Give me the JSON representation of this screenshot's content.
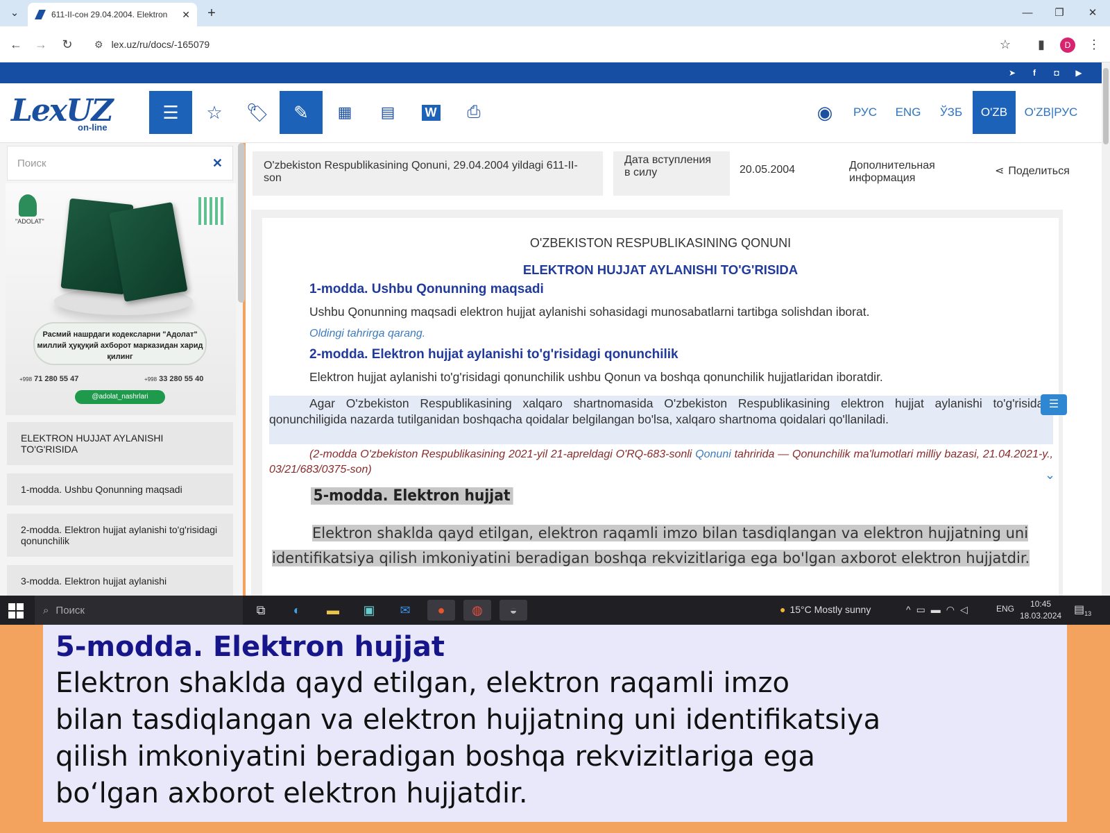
{
  "browser": {
    "tab_title": "611-II-сон 29.04.2004. Elektron",
    "url": "lex.uz/ru/docs/-165079",
    "profile_initial": "D"
  },
  "site": {
    "logo_main": "LexUZ",
    "logo_sub": "on-line",
    "languages": [
      "РУС",
      "ENG",
      "ЎЗБ",
      "O'ZB",
      "O'ZB|РУС"
    ],
    "active_language": "O'ZB",
    "toolbar_icons": [
      "menu-icon",
      "star-icon",
      "tags-icon",
      "edit-doc-icon",
      "calendar-icon",
      "compare-icon",
      "word-icon",
      "print-icon"
    ]
  },
  "sidebar": {
    "search_placeholder": "Поиск",
    "banner": {
      "logo_text": "\"ADOLAT\"",
      "caption": "Расмий нашрдаги кодексларни \"Адолат\" миллий ҳуқуқий ахборот марказидан харид қилинг",
      "phone1_prefix": "+998",
      "phone1": "71 280 55 47",
      "phone2_prefix": "+998",
      "phone2": "33 280 55 40",
      "telegram": "@adolat_nashrlari"
    },
    "items": [
      "ELEKTRON HUJJAT AYLANISHI TO'G'RISIDA",
      "1-modda. Ushbu Qonunning maqsadi",
      "2-modda. Elektron hujjat aylanishi to'g'risidagi qonunchilik",
      "3-modda. Elektron hujjat aylanishi"
    ]
  },
  "doc": {
    "title": "O'zbekiston Respublikasining Qonuni, 29.04.2004 yildagi 611-II-son",
    "effective_label": "Дата вступления в силу",
    "effective_date": "20.05.2004",
    "additional_info": "Дополнительная информация",
    "share": "Поделиться",
    "law_type": "O'ZBEKISTON RESPUBLIKASINING QONUNI",
    "law_title": "ELEKTRON HUJJAT AYLANISHI TO'G'RISIDA",
    "art1_title": "1-modda. Ushbu Qonunning maqsadi",
    "art1_text": "Ushbu Qonunning maqsadi elektron hujjat aylanishi sohasidagi munosabatlarni tartibga solishdan iborat.",
    "prev_edition": "Oldingi tahrirga qarang.",
    "art2_title": "2-modda. Elektron hujjat aylanishi to'g'risidagi qonunchilik",
    "art2_text1": "Elektron hujjat aylanishi to'g'risidagi qonunchilik ushbu Qonun va boshqa qonunchilik hujjatlaridan iboratdir.",
    "art2_text2": "Agar O'zbekiston Respublikasining xalqaro shartnomasida O'zbekiston Respublikasining elektron hujjat aylanishi to'g'risidagi qonunchiligida nazarda tutilganidan boshqacha qoidalar belgilangan bo'lsa, xalqaro shartnoma qoidalari qo'llaniladi.",
    "art2_note_a": "(2-modda O'zbekiston Respublikasining 2021-yil 21-apreldagi O'RQ-683-sonli ",
    "art2_note_link": "Qonuni",
    "art2_note_b": " tahririda — Qonunchilik ma'lumotlari milliy bazasi, 21.04.2021-y., 03/21/683/0375-son)",
    "art5_title": "5-modda. Elektron hujjat",
    "art5_text": "Elektron shaklda qayd etilgan, elektron raqamli imzo bilan tasdiqlangan va elektron hujjatning uni identifikatsiya qilish imkoniyatini beradigan boshqa rekvizitlariga ega bo'lgan axborot elektron hujjatdir."
  },
  "taskbar": {
    "search": "Поиск",
    "weather": "15°C  Mostly sunny",
    "lang": "ENG",
    "time": "10:45",
    "date": "18.03.2024",
    "notifications": "13"
  },
  "subtitle": {
    "heading": "5-modda. Elektron hujjat",
    "body": "Elektron shaklda qayd etilgan, elektron raqamli imzo\nbilan tasdiqlangan va elektron hujjatning uni identifikatsiya\nqilish imkoniyatini beradigan boshqa rekvizitlariga ega\nbo‘lgan axborot elektron hujjatdir."
  }
}
